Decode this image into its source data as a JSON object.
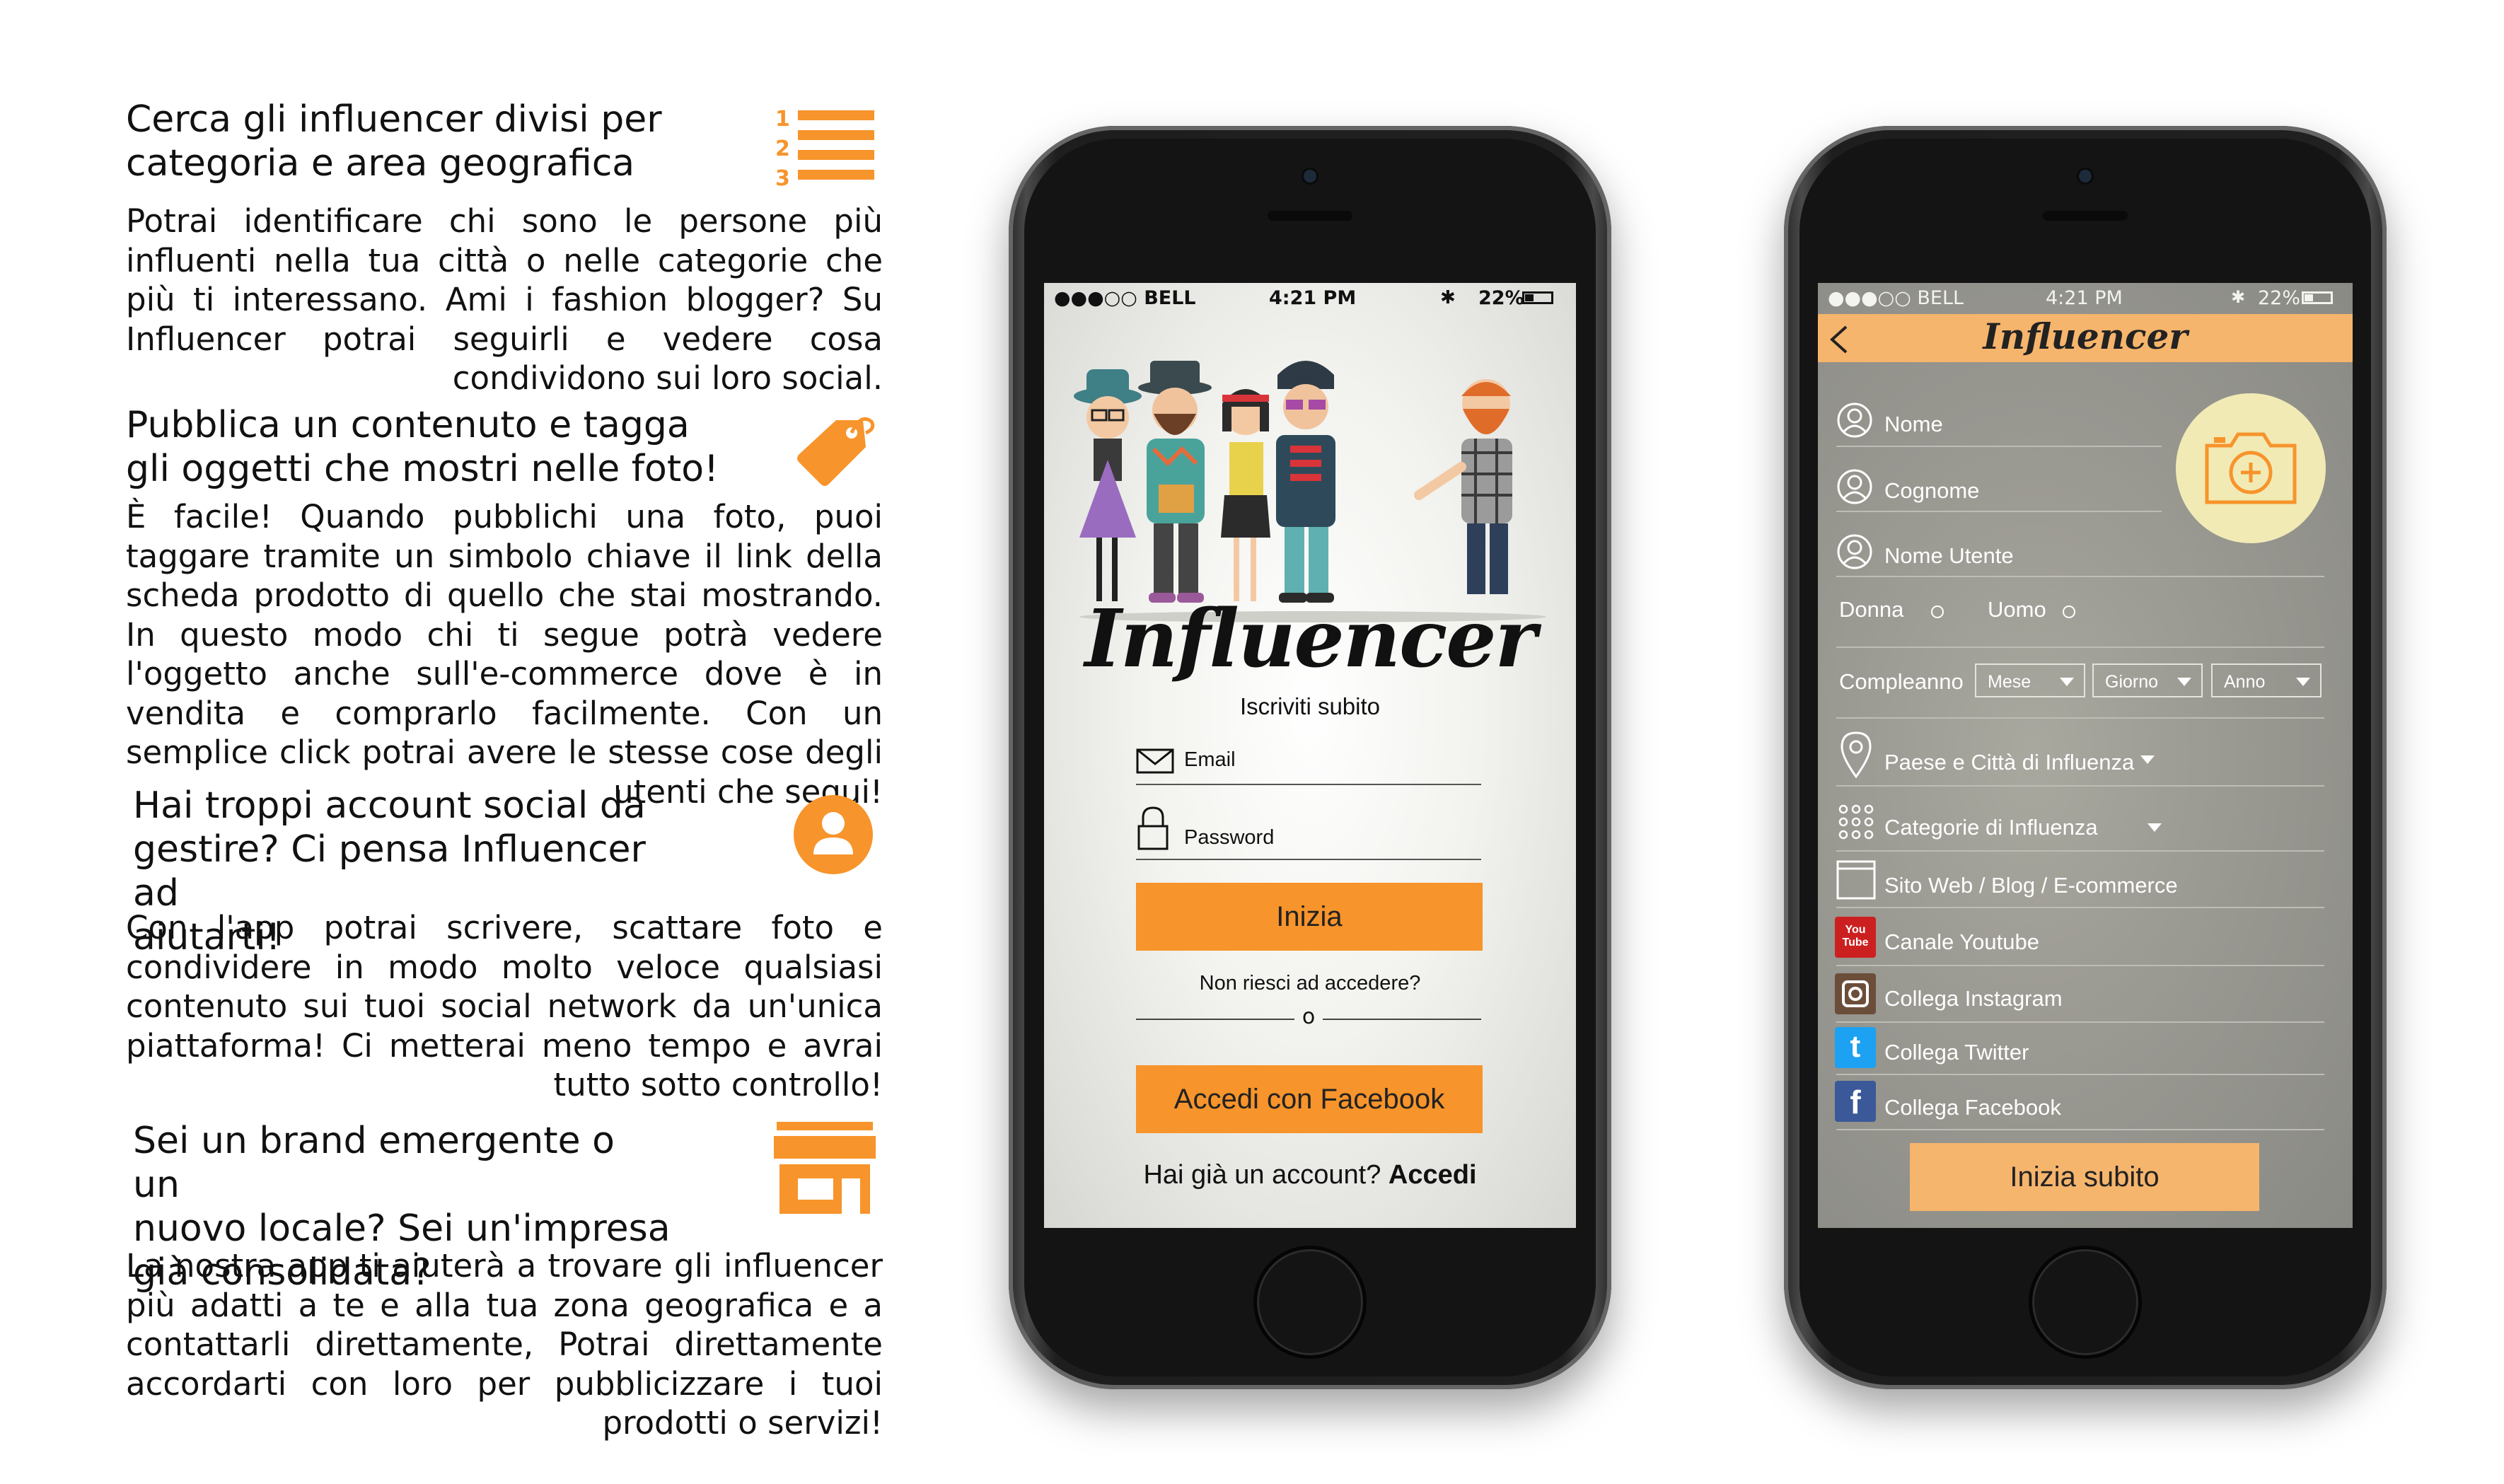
{
  "features": [
    {
      "title_lines": [
        "Cerca gli influencer divisi per",
        "categoria  e  area  geografica"
      ],
      "body": "Potrai identificare chi sono le persone più influenti nella tua città o nelle categorie che più ti interessano. Ami i fashion blogger? Su Influencer potrai seguirli e vedere cosa condividono sui loro social.",
      "icon": "numbered-list-icon",
      "icon_digits": [
        "1",
        "2",
        "3"
      ]
    },
    {
      "title_lines": [
        "Pubblica un contenuto e tagga",
        "gli oggetti che mostri nelle foto!"
      ],
      "body": "È facile! Quando pubblichi una foto, puoi taggare tramite un simbolo chiave il link della scheda prodotto di quello che stai mostrando. In questo modo chi ti segue potrà vedere l'oggetto anche sull'e-commerce dove è in vendita e comprarlo facilmente. Con un semplice click potrai avere le stesse cose degli utenti che segui!",
      "icon": "price-tag-icon"
    },
    {
      "title_lines": [
        "Hai  troppi  account  social  da",
        "gestire? Ci pensa Influencer ad",
        "aiutarti!"
      ],
      "body": "Con l'app potrai scrivere, scattare foto e condividere in modo molto veloce qualsiasi contenuto sui tuoi social network da un'unica piattaforma! Ci metterai meno tempo e avrai tutto sotto controllo!",
      "icon": "user-circle-icon"
    },
    {
      "title_lines": [
        "Sei un brand emergente o un",
        "nuovo locale? Sei un'impresa",
        "già consolidata?"
      ],
      "body": "La nostra app ti aiuterà a trovare gli influencer più adatti a te e alla tua zona geografica e a contattarli direttamente, Potrai direttamente accordarti con loro per pubblicizzare i tuoi prodotti o servizi!",
      "icon": "storefront-icon"
    }
  ],
  "phone1": {
    "status": {
      "carrier": "●●●○○ BELL",
      "time": "4:21 PM",
      "battery": "22%"
    },
    "logo": "Influencer",
    "subtitle": "Iscriviti subito",
    "email_label": "Email",
    "password_label": "Password",
    "start_button": "Inizia",
    "forgot": "Non riesci ad accedere?",
    "divider": "o",
    "facebook_button": "Accedi con Facebook",
    "have_account": "Hai già un account?",
    "login_link": "Accedi"
  },
  "phone2": {
    "status": {
      "carrier": "●●●○○ BELL",
      "time": "4:21 PM",
      "battery": "22%"
    },
    "header_logo": "Influencer",
    "fields": {
      "nome": "Nome",
      "cognome": "Cognome",
      "nome_utente": "Nome Utente",
      "donna": "Donna",
      "uomo": "Uomo",
      "compleanno": "Compleanno",
      "mese": "Mese",
      "giorno": "Giorno",
      "anno": "Anno",
      "paese": "Paese e Città di Influenza",
      "categorie": "Categorie di Influenza",
      "sito": "Sito Web / Blog / E-commerce",
      "youtube": "Canale Youtube",
      "instagram": "Collega Instagram",
      "twitter": "Collega Twitter",
      "facebook": "Collega Facebook"
    },
    "youtube_badge": [
      "You",
      "Tube"
    ],
    "twitter_glyph": "t",
    "facebook_glyph": "f",
    "submit": "Inizia subito"
  },
  "colors": {
    "accent": "#f7942b",
    "accent_light": "#f6b56c",
    "photo_circle": "#f2eab5",
    "facebook": "#3b5998",
    "twitter": "#1da1f2",
    "youtube": "#cc2020",
    "instagram": "#6b4e3a"
  }
}
